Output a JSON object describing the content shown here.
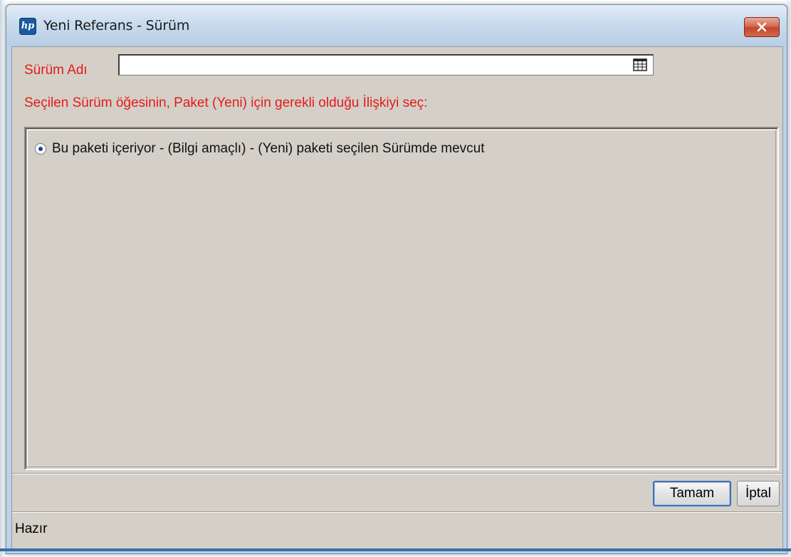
{
  "window": {
    "title": "Yeni Referans - Sürüm",
    "app_icon_text": "hp",
    "close_icon": "close-x-icon"
  },
  "form": {
    "name_label": "Sürüm Adı",
    "name_value": "",
    "picker_icon": "table-picker-icon",
    "instruction": "Seçilen Sürüm öğesinin, Paket (Yeni) için gerekli olduğu İlişkiyi seç:"
  },
  "options": [
    {
      "label": "Bu paketi içeriyor - (Bilgi amaçlı) - (Yeni) paketi seçilen Sürümde mevcut",
      "selected": true
    }
  ],
  "buttons": {
    "ok_label": "Tamam",
    "cancel_label": "İptal"
  },
  "status": {
    "text": "Hazır"
  },
  "colors": {
    "label_red": "#e41b1b",
    "client_bg": "#d4d0c8",
    "close_red": "#c2452c",
    "default_button_border": "#3c6fb7"
  }
}
